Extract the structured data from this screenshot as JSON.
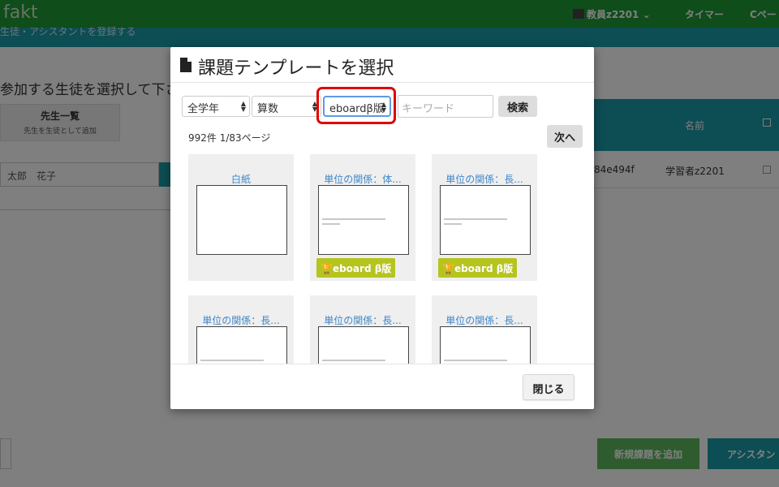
{
  "app": {
    "logo": "fakt",
    "user_label": "教員z2201",
    "timer_label": "タイマー",
    "top_button2": "Cペー",
    "subbar_text": "生徒・アシスタントを登録する"
  },
  "background": {
    "heading": "参加する生徒を選択して下さ",
    "teacher_button": {
      "title": "先生一覧",
      "subtitle": "先生を生徒として追加"
    },
    "student_field": "太郎　花子",
    "table_header_name": "名前",
    "row": {
      "id": "84e494f",
      "name": "学習者z2201"
    },
    "add_task_button": "新規課題を追加",
    "assistant_button": "アシスタン"
  },
  "modal": {
    "title": "課題テンプレートを選択",
    "filters": {
      "grade": "全学年",
      "subject": "算数",
      "series": "eboardβ版",
      "keyword_placeholder": "キーワード",
      "search_label": "検索"
    },
    "result_count": "992件 1/83ページ",
    "next_label": "次へ",
    "cards": [
      {
        "title": "白紙",
        "badge": ""
      },
      {
        "title": "単位の関係：体...",
        "badge": "eboard β版"
      },
      {
        "title": "単位の関係：長...",
        "badge": "eboard β版"
      },
      {
        "title": "単位の関係：長...",
        "badge": ""
      },
      {
        "title": "単位の関係：長...",
        "badge": ""
      },
      {
        "title": "単位の関係：長...",
        "badge": ""
      }
    ],
    "close_label": "閉じる"
  },
  "colors": {
    "topbar": "#1f9a36",
    "teal": "#1a9aa8",
    "card_title": "#3f87c9",
    "badge": "#b6c41e",
    "highlight": "#e00000"
  }
}
